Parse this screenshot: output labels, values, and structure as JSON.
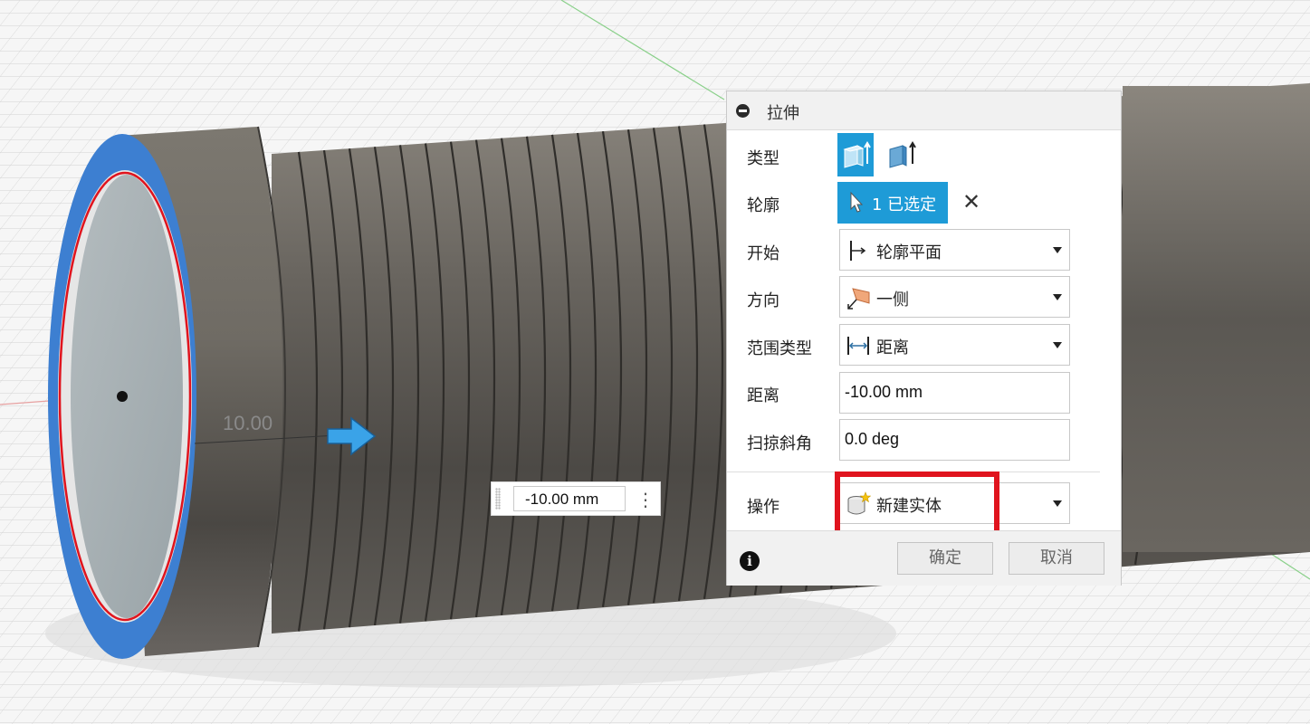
{
  "canvas": {
    "dimension_label": "10.00",
    "floating_distance_value": "-10.00 mm"
  },
  "dialog": {
    "title": "拉伸",
    "rows": {
      "type_label": "类型",
      "profile_label": "轮廓",
      "start_label": "开始",
      "direction_label": "方向",
      "extent_type_label": "范围类型",
      "distance_label": "距离",
      "taper_label": "扫掠斜角",
      "operation_label": "操作"
    },
    "type_options": [
      {
        "icon": "extrude-solid-icon",
        "active": true
      },
      {
        "icon": "extrude-thin-icon",
        "active": false
      }
    ],
    "profile_selection": "1 已选定",
    "start_value": "轮廓平面",
    "start_icon": "profile-plane-icon",
    "direction_value": "一侧",
    "direction_icon": "one-side-icon",
    "extent_type_value": "距离",
    "extent_type_icon": "distance-icon",
    "distance_value": "-10.00 mm",
    "taper_value": "0.0 deg",
    "operation_value": "新建实体",
    "operation_icon": "new-body-icon",
    "ok_label": "确定",
    "cancel_label": "取消",
    "accent_color": "#1e9bd7",
    "highlight_color": "#e0141e"
  }
}
